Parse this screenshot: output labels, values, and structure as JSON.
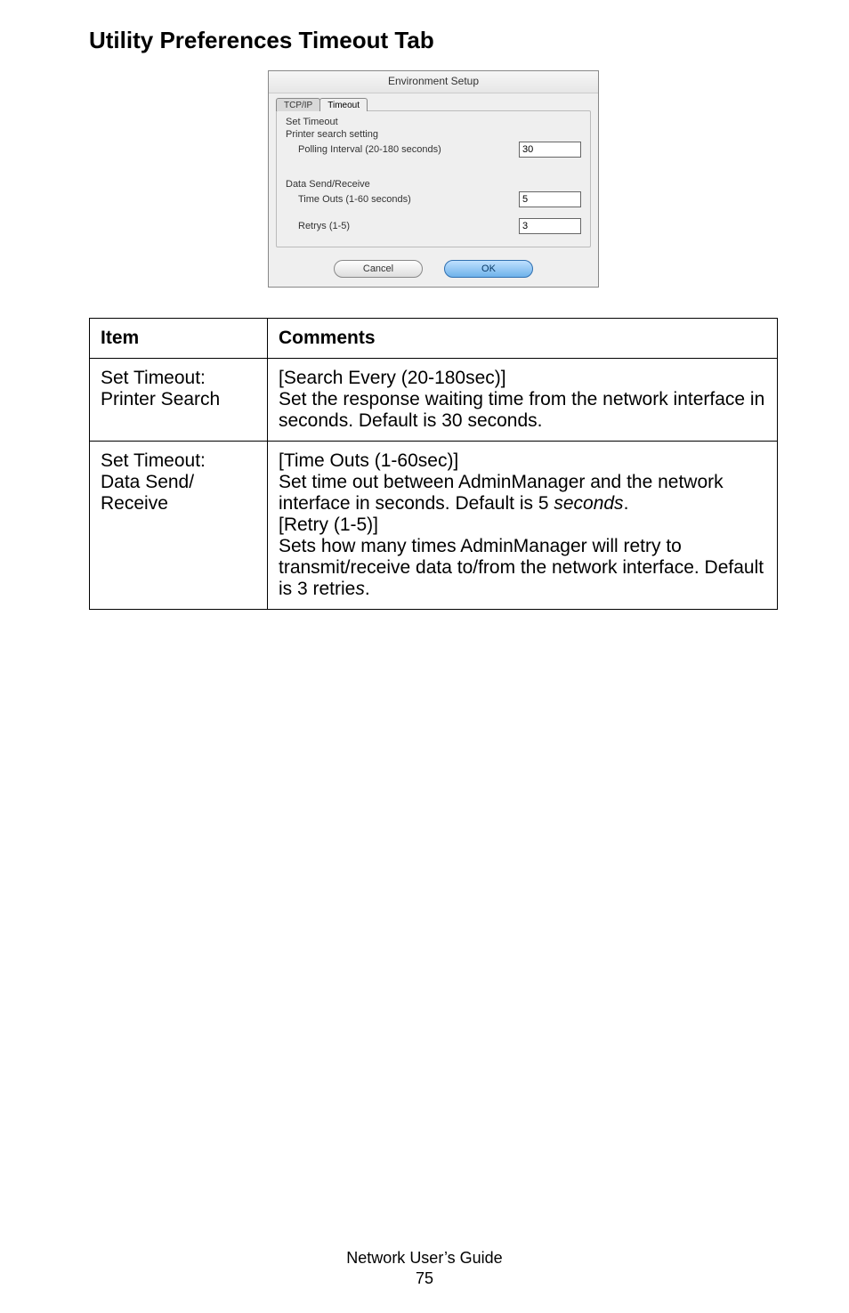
{
  "heading": "Utility Preferences Timeout Tab",
  "dialog": {
    "title": "Environment Setup",
    "tab_tcpip": "TCP/IP",
    "tab_timeout": "Timeout",
    "group_title": "Set Timeout",
    "printer_search": "Printer search setting",
    "polling_label": "Polling Interval (20-180 seconds)",
    "polling_value": "30",
    "data_sr": "Data Send/Receive",
    "timeouts_label": "Time Outs (1-60 seconds)",
    "timeouts_value": "5",
    "retrys_label": "Retrys (1-5)",
    "retrys_value": "3",
    "cancel": "Cancel",
    "ok": "OK"
  },
  "table": {
    "head_item": "Item",
    "head_comments": "Comments",
    "r1_item_a": "Set Timeout:",
    "r1_item_b": "Printer Search",
    "r1_c1": "[Search Every (20-180sec)]",
    "r1_c2": "Set the response waiting time from the network interface in seconds. Default is 30 seconds.",
    "r2_item_a": "Set Timeout:",
    "r2_item_b": "Data Send/",
    "r2_item_c": "Receive",
    "r2_c1": "[Time Outs (1-60sec)]",
    "r2_c2a": "Set time out between AdminManager and the network interface in seconds. Default is 5 ",
    "r2_c2b": "seconds",
    "r2_c2c": ".",
    "r2_c3": "[Retry (1-5)]",
    "r2_c4a": "Sets how many times AdminManager will retry to transmit/receive data to/from the network interface. Default is 3 retrie",
    "r2_c4b": "s",
    "r2_c4c": "."
  },
  "footer": {
    "guide": "Network User’s Guide",
    "page": "75"
  }
}
